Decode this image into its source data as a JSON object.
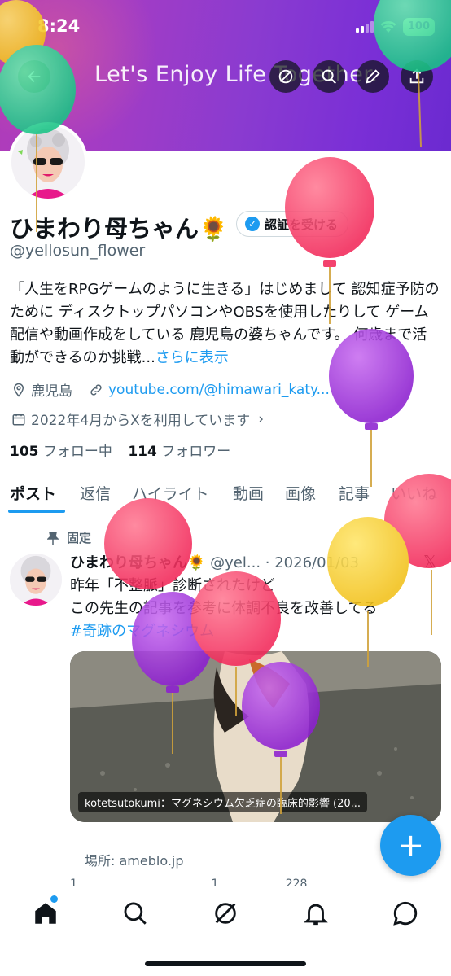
{
  "status_bar": {
    "time": "8:24",
    "battery": "100"
  },
  "header": {
    "banner_text": "Let's Enjoy Life Together.",
    "icons": [
      "back-arrow-icon",
      "grok-icon",
      "search-icon",
      "pencil-icon",
      "share-icon"
    ]
  },
  "profile": {
    "name": "ひまわり母ちゃん🌻",
    "verify_label": "認証を受ける",
    "handle": "@yellosun_flower",
    "bio": "「人生をRPGゲームのように生きる」はじめまして 認知症予防のために ディスクトップパソコンやOBSを使用したりして ゲーム配信や動画作成をしている 鹿児島の婆ちゃんです。 何歳まで活動ができるのか挑戦...",
    "bio_more": "さらに表示",
    "location": "鹿児島",
    "link": "youtube.com/@himawari_katy...",
    "joined": "2022年4月からXを利用しています",
    "following_count": "105",
    "following_label": "フォロー中",
    "followers_count": "114",
    "followers_label": "フォロワー"
  },
  "tabs": [
    "ポスト",
    "返信",
    "ハイライト",
    "動画",
    "画像",
    "記事",
    "いいね"
  ],
  "active_tab": "ポスト",
  "post": {
    "pinned_label": "固定",
    "author": "ひまわり母ちゃん🌻",
    "handle_date": "@yel... · 2026/01/03",
    "line1": "昨年「不整脈」診断されたけど",
    "line2": "この先生の記事を参考に体調不良を改善してる",
    "hashtag": "#奇跡のマグネシウム",
    "card_caption": "kotetsutokumi：マグネシウム欠乏症の臨床的影響 (20...",
    "place": "場所: ameblo.jp",
    "actions": [
      "1",
      "",
      "1",
      "228",
      "",
      ""
    ]
  },
  "fab_label": "+",
  "bottom_nav": [
    "home-icon",
    "search-icon",
    "grok-icon",
    "notifications-icon",
    "messages-icon"
  ],
  "colors": {
    "accent": "#1d9bf0",
    "banner_start": "#b13cb8",
    "banner_end": "#6b2ad0"
  }
}
